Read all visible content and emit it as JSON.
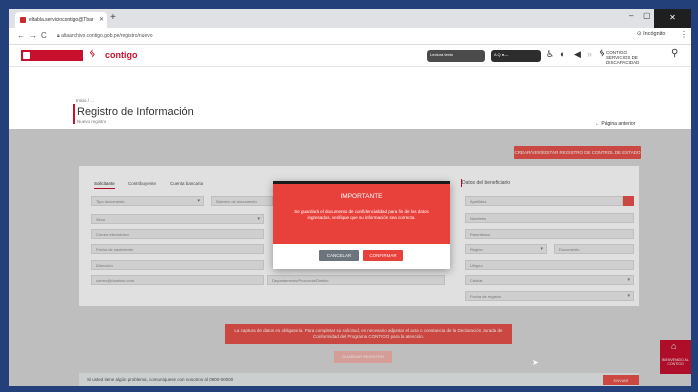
{
  "browser": {
    "tab_title": "eltabla.serviciocontigo@Tbar",
    "url": "altaarchivo.contigo.gob.pe/registro/nuevo",
    "incognito_label": "Incógnito",
    "new_tab": "+",
    "back": "←",
    "forward": "→",
    "reload": "C",
    "menu": "⋮"
  },
  "site_header": {
    "brand": "contigo",
    "access_btn_1": "Lectura texto",
    "access_btn_2": "A  Q  ●—",
    "spacer_name": "CONTIGO",
    "spacer_sub": "SERVICIOS DE DISCAPACIDAD"
  },
  "page": {
    "breadcrumb": "Inicio / ...",
    "title": "Registro de Información",
    "subtitle": "Nuevo registro",
    "prev_link": "← Página anterior",
    "create_button": "CREAR/VER/EDITAR REGISTRO DE CONTROL DE ESTADO"
  },
  "form": {
    "tabs": [
      "Solicitante",
      "Contribuyente",
      "Cuenta bancaria"
    ],
    "right_title": "Datos del beneficiario",
    "fields_left": [
      "Tipo documento",
      "",
      "Sexo",
      "Correo electrónico",
      "Fecha de nacimiento",
      "Dirección",
      "correo@dominio.com"
    ],
    "fields_mid": [
      "Número de documento",
      "",
      "",
      "",
      "",
      "Departamento/Provincia/Distrito"
    ],
    "fields_right": [
      "Apellidos",
      "Nombres",
      "Parentesco",
      "Región",
      "Ubigeo",
      "Celular",
      "Fecha de registro"
    ],
    "field_right_extra": "Documento"
  },
  "bottom": {
    "message": "La captura de datos es obligatoria. Para completar su solicitud, es necesario adjuntar el acta o constancia de la Declaración Jurada de Conformidad del Programa CONTIGO para la atención.",
    "faint_button": "GUARDAR REGISTRO",
    "footer_text": "Si usted tiene algún problema, comuníquese con nosotros al 0800-00000",
    "footer_button": "ENVIAR",
    "badge": "BIENVENIDO AL CONTIGO"
  },
  "modal": {
    "title": "IMPORTANTE",
    "text": "Se guardará el documento de confidencialidad para fin de los datos ingresados, verifique que su información sea correcta.",
    "cancel": "CANCELAR",
    "confirm": "CONFIRMAR"
  },
  "colors": {
    "accent": "#e8403a",
    "brand_red": "#c8102e"
  }
}
